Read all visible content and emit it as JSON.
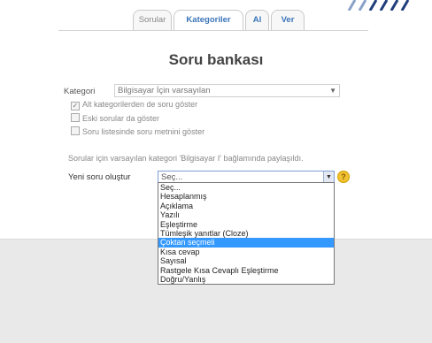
{
  "tabs": [
    {
      "label": "Sorular"
    },
    {
      "label": "Kategoriler"
    },
    {
      "label": "Al"
    },
    {
      "label": "Ver"
    }
  ],
  "title": "Soru bankası",
  "category": {
    "label": "Kategori",
    "value": "Bilgisayar İçin varsayılan"
  },
  "checkboxes": [
    {
      "label": "Alt kategorilerden de soru göster",
      "checked": true
    },
    {
      "label": "Eski sorular da göster",
      "checked": false
    },
    {
      "label": "Soru listesinde soru metnini göster",
      "checked": false
    }
  ],
  "info_text": "Sorular için varsayılan kategori 'Bilgisayar I' bağlamında paylaşıldı.",
  "new_question": {
    "label": "Yeni soru oluştur",
    "value": "Seç..."
  },
  "dropdown_options": [
    {
      "label": "Seç..."
    },
    {
      "label": "Hesaplanmış"
    },
    {
      "label": "Açıklama"
    },
    {
      "label": "Yazılı"
    },
    {
      "label": "Eşleştirme"
    },
    {
      "label": "Tümleşik yanıtlar (Cloze)"
    },
    {
      "label": "Çoktan seçmeli"
    },
    {
      "label": "Kısa cevap"
    },
    {
      "label": "Sayısal"
    },
    {
      "label": "Rastgele Kısa Cevaplı Eşleştirme"
    },
    {
      "label": "Doğru/Yanlış"
    }
  ],
  "highlighted_option": "Çoktan seçmeli",
  "colors": {
    "accent": "#3a74b8",
    "highlight": "#3399ff",
    "help": "#f1c232"
  },
  "icons": {
    "help": "help-icon",
    "dropdown_arrow": "chevron-down-icon"
  }
}
